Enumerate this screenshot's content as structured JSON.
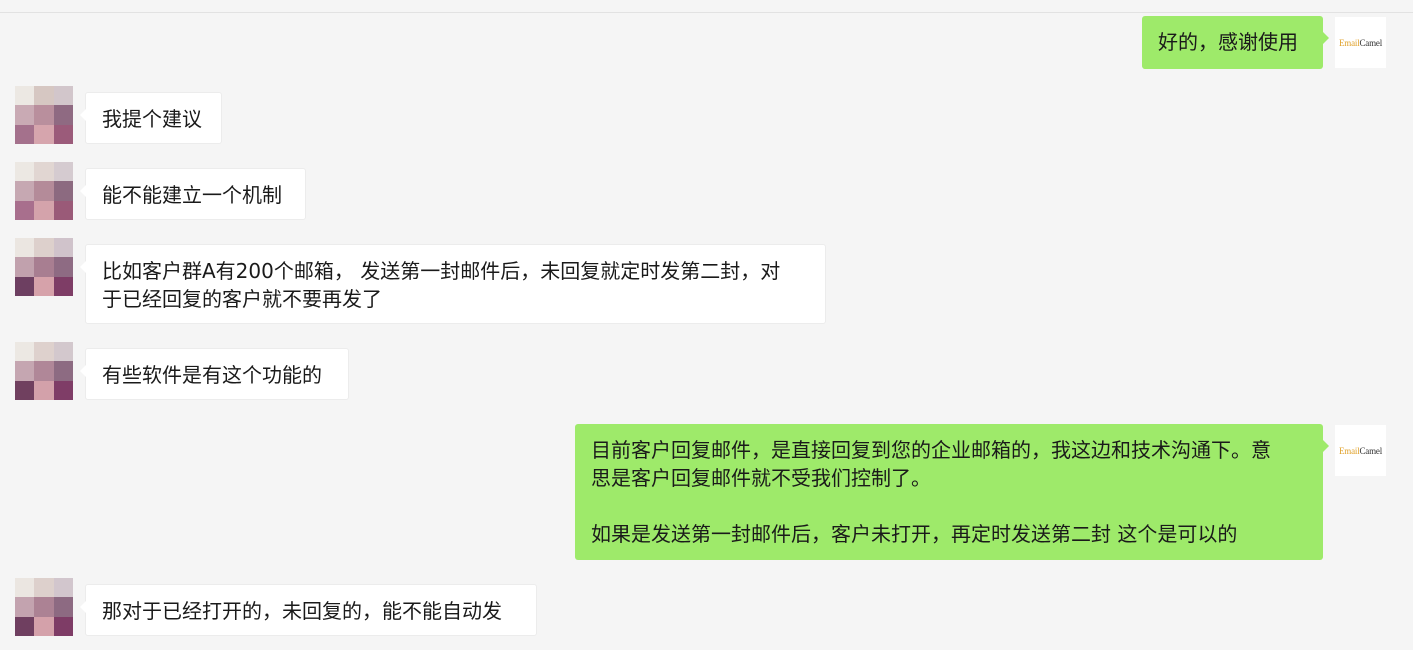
{
  "self_avatar": {
    "brand_part1": "Email",
    "brand_part2": "Camel",
    "brand_colors": {
      "email": "#e0a12a",
      "camel": "#333333"
    }
  },
  "colors": {
    "background": "#f5f5f5",
    "bubble_incoming": "#ffffff",
    "bubble_outgoing": "#9eea6a"
  },
  "messages": [
    {
      "sender": "self",
      "text": "好的，感谢使用"
    },
    {
      "sender": "contact",
      "text": "我提个建议"
    },
    {
      "sender": "contact",
      "text": "能不能建立一个机制"
    },
    {
      "sender": "contact",
      "text": "比如客户群A有200个邮箱， 发送第一封邮件后，未回复就定时发第二封，对\n于已经回复的客户就不要再发了"
    },
    {
      "sender": "contact",
      "text": "有些软件是有这个功能的"
    },
    {
      "sender": "self",
      "text": "目前客户回复邮件，是直接回复到您的企业邮箱的，我这边和技术沟通下。意\n思是客户回复邮件就不受我们控制了。\n\n如果是发送第一封邮件后，客户未打开，再定时发送第二封 这个是可以的"
    },
    {
      "sender": "contact",
      "text": "那对于已经打开的，未回复的，能不能自动发"
    }
  ]
}
